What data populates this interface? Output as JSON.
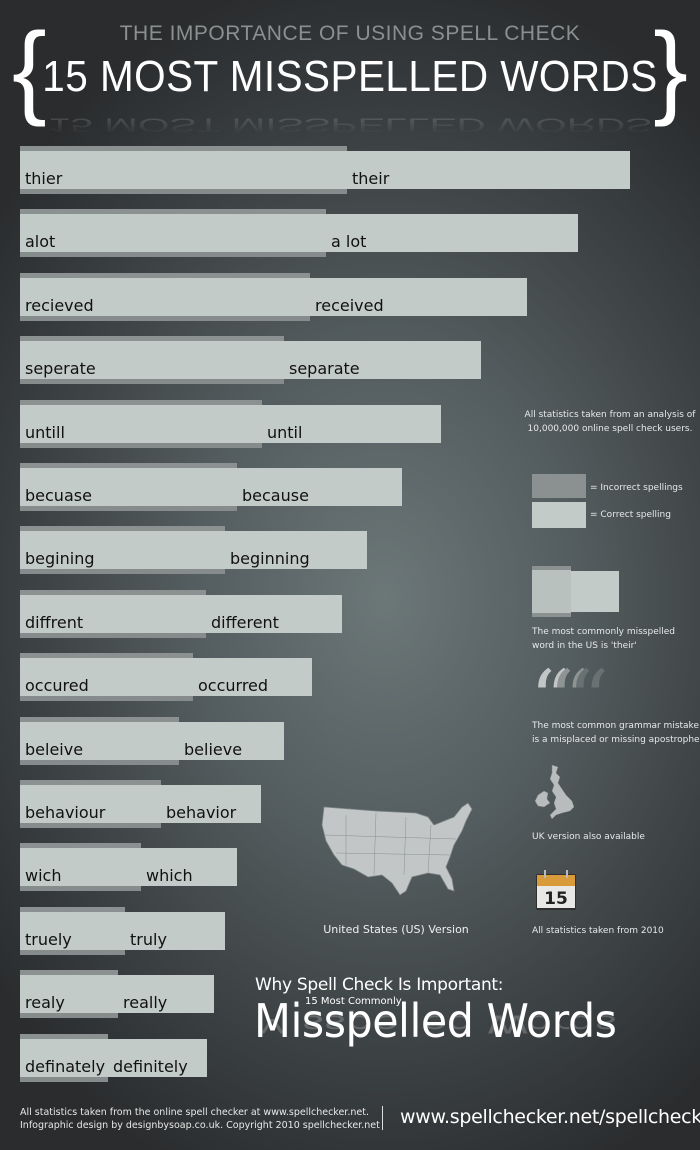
{
  "header": {
    "subtitle": "THE IMPORTANCE OF USING SPELL CHECK",
    "title": "15 MOST MISSPELLED WORDS",
    "brace_left": "{",
    "brace_right": "}"
  },
  "chart_data": {
    "type": "bar",
    "orientation": "horizontal",
    "stacked": true,
    "title": "15 Most Misspelled Words",
    "categories": [
      "thier",
      "alot",
      "recieved",
      "seperate",
      "untill",
      "becuase",
      "begining",
      "diffrent",
      "occured",
      "beleive",
      "behaviour",
      "wich",
      "truely",
      "realy",
      "definately"
    ],
    "correct_labels": [
      "their",
      "a lot",
      "received",
      "separate",
      "until",
      "because",
      "beginning",
      "different",
      "occurred",
      "believe",
      "behavior",
      "which",
      "truly",
      "really",
      "definitely"
    ],
    "series": [
      {
        "name": "Incorrect spellings",
        "color": "#8a9190",
        "values": [
          327,
          306,
          290,
          264,
          242,
          217,
          205,
          186,
          173,
          159,
          141,
          121,
          105,
          98,
          88
        ]
      },
      {
        "name": "Correct spelling",
        "color": "#c3cbc9",
        "values": [
          283,
          252,
          217,
          197,
          179,
          165,
          142,
          136,
          119,
          105,
          100,
          96,
          100,
          96,
          99
        ]
      }
    ],
    "units": "relative bar length (no axis printed)",
    "xlabel": "",
    "ylabel": "",
    "grid": false,
    "legend": "right"
  },
  "sidebar": {
    "stats_note": "All statistics taken from an analysis of 10,000,000 online spell check users.",
    "legend_incorrect": "= Incorrect spellings",
    "legend_correct": "= Correct spelling",
    "most_common_note": "The most commonly misspelled word in the US is 'their'",
    "quote_icon": "quote-icon",
    "grammar_note": "The most common grammar mistake is a misplaced or missing apostrophe",
    "uk_icon": "uk-map-icon",
    "uk_note": "UK version also available",
    "calendar_icon": "calendar-icon",
    "calendar_day": "15",
    "calendar_note": "All statistics taken from 2010"
  },
  "us_map": {
    "icon": "us-map-icon",
    "label": "United States (US) Version"
  },
  "bottom_title": {
    "why": "Why Spell Check Is Important:",
    "sub": "15 Most Commonly",
    "big": "Misspelled Words"
  },
  "footer": {
    "credits_line1": "All statistics taken from the online spell checker at www.spellchecker.net.",
    "credits_line2": "Infographic design by designbysoap.co.uk. Copyright 2010 spellchecker.net",
    "url": "www.spellchecker.net/spellcheck"
  }
}
